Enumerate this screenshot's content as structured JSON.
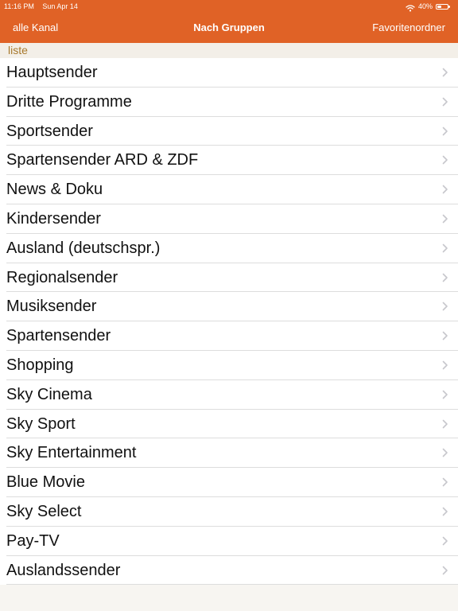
{
  "statusbar": {
    "time": "11:16 PM",
    "date": "Sun Apr 14",
    "battery": "40%",
    "battery_level": 0.4,
    "wifi_icon": "wifi-icon",
    "battery_icon": "battery-icon"
  },
  "navbar": {
    "left_label": "alle Kanal",
    "title": "Nach Gruppen",
    "right_label": "Favoritenordner"
  },
  "section": {
    "header": "liste"
  },
  "list": {
    "items": [
      {
        "label": "Hauptsender"
      },
      {
        "label": "Dritte Programme"
      },
      {
        "label": "Sportsender"
      },
      {
        "label": "Spartensender ARD & ZDF"
      },
      {
        "label": "News & Doku"
      },
      {
        "label": "Kindersender"
      },
      {
        "label": "Ausland (deutschspr.)"
      },
      {
        "label": "Regionalsender"
      },
      {
        "label": "Musiksender"
      },
      {
        "label": "Spartensender"
      },
      {
        "label": "Shopping"
      },
      {
        "label": "Sky Cinema"
      },
      {
        "label": "Sky Sport"
      },
      {
        "label": "Sky Entertainment"
      },
      {
        "label": "Blue Movie"
      },
      {
        "label": "Sky Select"
      },
      {
        "label": "Pay-TV"
      },
      {
        "label": "Auslandssender"
      }
    ],
    "chevron_icon": "chevron-right-icon"
  },
  "colors": {
    "accent": "#e06226",
    "section_text": "#a8792d",
    "background": "#f7f5f1",
    "divider": "#dddddd",
    "chevron": "#c7c7cc"
  }
}
